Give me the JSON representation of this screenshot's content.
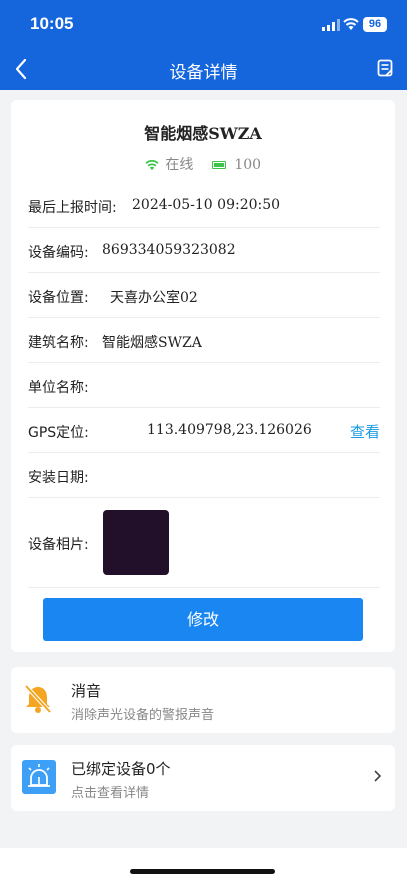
{
  "status_bar": {
    "time": "10:05",
    "battery": "96"
  },
  "nav": {
    "title": "设备详情"
  },
  "device": {
    "name": "智能烟感SWZA",
    "online_text": "在线",
    "battery_value": "100"
  },
  "fields": [
    {
      "label": "最后上报时间:",
      "value": "2024-05-10 09:20:50"
    },
    {
      "label": "设备编码:",
      "value": "869334059323082"
    },
    {
      "label": "设备位置:",
      "value": "天喜办公室02"
    },
    {
      "label": "建筑名称:",
      "value": "智能烟感SWZA"
    },
    {
      "label": "单位名称:",
      "value": ""
    },
    {
      "label": "GPS定位:",
      "value": "113.409798,23.126026",
      "link": "查看"
    },
    {
      "label": "安装日期:",
      "value": ""
    }
  ],
  "photo": {
    "label": "设备相片:"
  },
  "edit_button": "修改",
  "mute": {
    "title": "消音",
    "subtitle": "消除声光设备的警报声音"
  },
  "bound": {
    "title": "已绑定设备0个",
    "subtitle": "点击查看详情"
  },
  "colors": {
    "primary": "#1565dd",
    "button": "#1a86f2",
    "link": "#1a9be6",
    "online": "#3cc44a",
    "mute_icon": "#f4a623"
  }
}
